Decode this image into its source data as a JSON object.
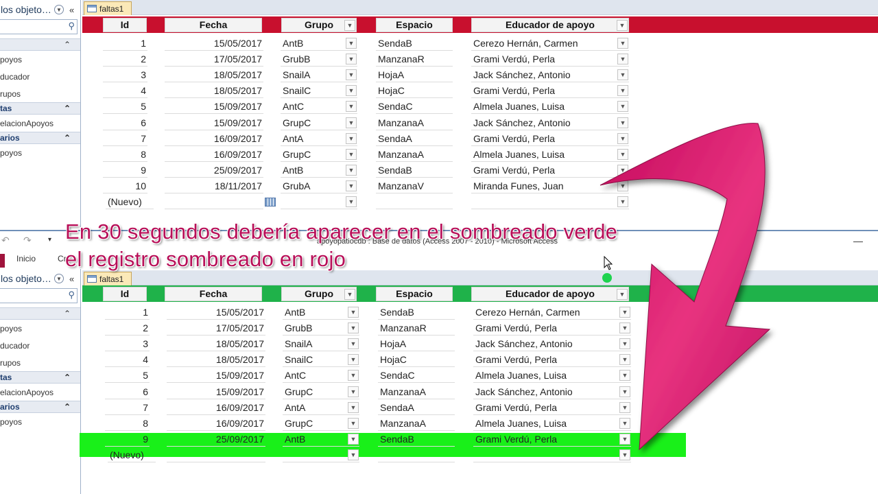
{
  "colors": {
    "top_header_band": "#c8102e",
    "bottom_header_band": "#1fb24a",
    "highlight": "#19f019",
    "caption": "#b80f58",
    "arrow": "#d1156d"
  },
  "nav": {
    "header": "los objeto…",
    "header2": "los objeto…",
    "items": [
      {
        "type": "group",
        "label": "",
        "collapse_icon": "chevron-up-icon"
      },
      {
        "type": "item",
        "label": "poyos"
      },
      {
        "type": "item",
        "label": "ducador"
      },
      {
        "type": "item",
        "label": "rupos"
      },
      {
        "type": "group",
        "label": "tas"
      },
      {
        "type": "item",
        "label": "elacionApoyos"
      },
      {
        "type": "group",
        "label": "arios"
      },
      {
        "type": "item",
        "label": "poyos"
      }
    ]
  },
  "tab_label": "faltas1",
  "columns": [
    "Id",
    "Fecha",
    "Grupo",
    "Espacio",
    "Educador  de apoyo"
  ],
  "top_rows": [
    [
      "1",
      "15/05/2017",
      "AntB",
      "SendaB",
      "Cerezo Hernán, Carmen"
    ],
    [
      "2",
      "17/05/2017",
      "GrubB",
      "ManzanaR",
      "Grami Verdú, Perla"
    ],
    [
      "3",
      "18/05/2017",
      "SnailA",
      "HojaA",
      "Jack Sánchez, Antonio"
    ],
    [
      "4",
      "18/05/2017",
      "SnailC",
      "HojaC",
      "Grami Verdú, Perla"
    ],
    [
      "5",
      "15/09/2017",
      "AntC",
      "SendaC",
      "Almela Juanes, Luisa"
    ],
    [
      "6",
      "15/09/2017",
      "GrupC",
      "ManzanaA",
      "Jack Sánchez, Antonio"
    ],
    [
      "7",
      "16/09/2017",
      "AntA",
      "SendaA",
      "Grami Verdú, Perla"
    ],
    [
      "8",
      "16/09/2017",
      "GrupC",
      "ManzanaA",
      "Almela Juanes, Luisa"
    ],
    [
      "9",
      "25/09/2017",
      "AntB",
      "SendaB",
      "Grami Verdú, Perla"
    ],
    [
      "10",
      "18/11/2017",
      "GrubA",
      "ManzanaV",
      "Miranda Funes, Juan"
    ]
  ],
  "bottom_rows": [
    [
      "1",
      "15/05/2017",
      "AntB",
      "SendaB",
      "Cerezo Hernán, Carmen"
    ],
    [
      "2",
      "17/05/2017",
      "GrubB",
      "ManzanaR",
      "Grami Verdú, Perla"
    ],
    [
      "3",
      "18/05/2017",
      "SnailA",
      "HojaA",
      "Jack Sánchez, Antonio"
    ],
    [
      "4",
      "18/05/2017",
      "SnailC",
      "HojaC",
      "Grami Verdú, Perla"
    ],
    [
      "5",
      "15/09/2017",
      "AntC",
      "SendaC",
      "Almela Juanes, Luisa"
    ],
    [
      "6",
      "15/09/2017",
      "GrupC",
      "ManzanaA",
      "Jack Sánchez, Antonio"
    ],
    [
      "7",
      "16/09/2017",
      "AntA",
      "SendaA",
      "Grami Verdú, Perla"
    ],
    [
      "8",
      "16/09/2017",
      "GrupC",
      "ManzanaA",
      "Almela Juanes, Luisa"
    ],
    [
      "9",
      "25/09/2017",
      "AntB",
      "SendaB",
      "Grami Verdú, Perla"
    ]
  ],
  "new_row_label": "(Nuevo)",
  "window": {
    "title": "apoyopatiocdb : Base de datos (Access 2007 - 2010) - Microsoft Access",
    "ribbon_tabs": [
      "Inicio",
      "Cr"
    ]
  },
  "caption": {
    "line1": "En 30 segundos debería aparecer en el sombreado verde",
    "line2": "el registro sombreado en rojo"
  }
}
